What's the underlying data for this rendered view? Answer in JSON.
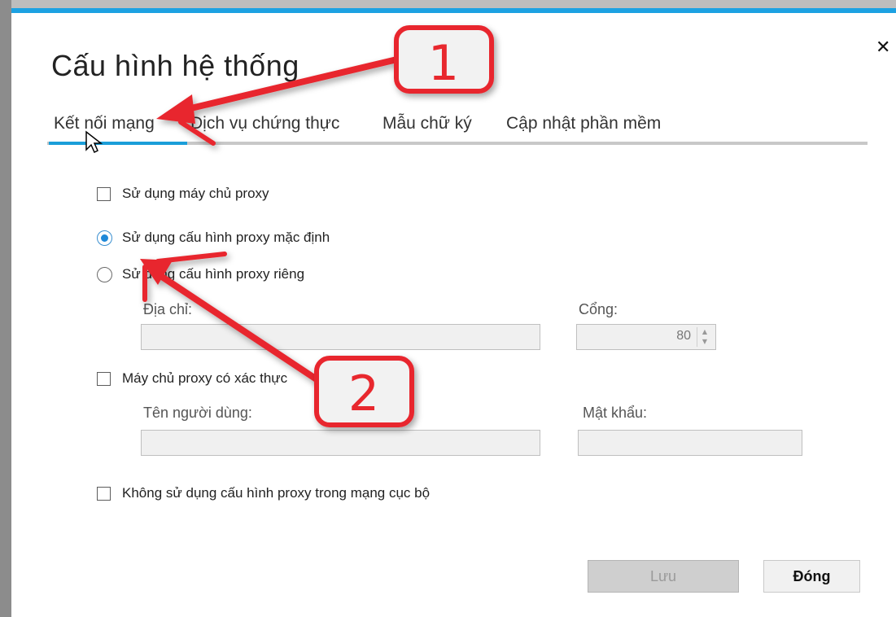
{
  "dialog": {
    "title": "Cấu hình hệ thống",
    "close_glyph": "✕"
  },
  "tabs": [
    {
      "label": "Kết nối mạng",
      "active": true
    },
    {
      "label": "Dịch vụ chứng thực",
      "active": false
    },
    {
      "label": "Mẫu chữ ký",
      "active": false
    },
    {
      "label": "Cập nhật phần mềm",
      "active": false
    }
  ],
  "options": {
    "use_proxy_label": "Sử dụng máy chủ proxy",
    "use_proxy_checked": false,
    "default_proxy_label": "Sử dụng cấu hình proxy mặc định",
    "default_proxy_selected": true,
    "custom_proxy_label": "Sử dụng cấu hình proxy riêng",
    "custom_proxy_selected": false,
    "address_label": "Địa chỉ:",
    "address_value": "",
    "port_label": "Cổng:",
    "port_value": "80",
    "auth_label": "Máy chủ proxy có xác thực",
    "auth_checked": false,
    "username_label": "Tên người dùng:",
    "username_value": "",
    "password_label": "Mật khẩu:",
    "password_value": "",
    "no_local_label": "Không sử dụng cấu hình proxy trong mạng cục bộ",
    "no_local_checked": false
  },
  "buttons": {
    "save_label": "Lưu",
    "close_label": "Đóng"
  },
  "annotations": {
    "callout_1": "1",
    "callout_2": "2",
    "color": "#e8282e"
  },
  "colors": {
    "accent": "#1a9ed9",
    "annotation_red": "#e8282e"
  }
}
